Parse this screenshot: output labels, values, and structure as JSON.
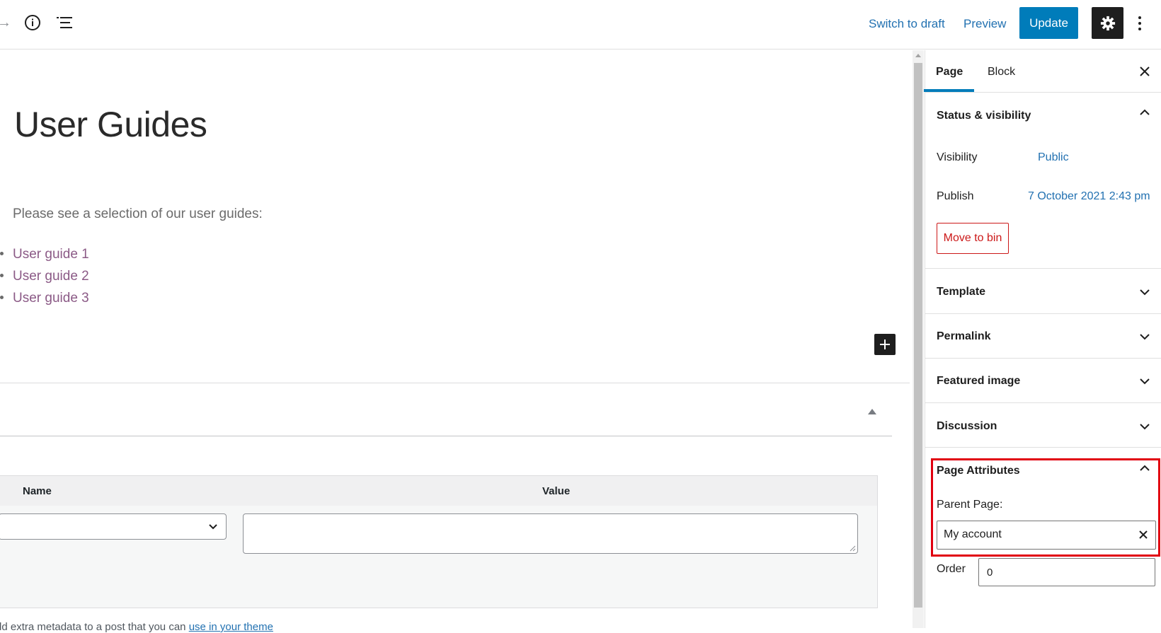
{
  "toolbar": {
    "redo_icon": "arrow-right-icon",
    "info_icon": "info-icon",
    "list_view_icon": "list-view-icon",
    "switch_to_draft": "Switch to draft",
    "preview": "Preview",
    "update": "Update",
    "settings_icon": "gear-icon",
    "more_icon": "vertical-ellipsis-icon"
  },
  "editor": {
    "title": "User Guides",
    "paragraph": "Please see a selection of our user guides:",
    "list_items": [
      "User guide 1",
      "User guide 2",
      "User guide 3"
    ],
    "add_block_icon": "plus-icon"
  },
  "custom_fields": {
    "columns": {
      "name": "Name",
      "value": "Value"
    },
    "help_text": "dd extra metadata to a post that you can ",
    "help_link": "use in your theme"
  },
  "sidebar": {
    "tabs": [
      "Page",
      "Block"
    ],
    "active_tab": "Page",
    "status_visibility": {
      "title": "Status & visibility",
      "visibility_label": "Visibility",
      "visibility_value": "Public",
      "publish_label": "Publish",
      "publish_value": "7 October 2021 2:43 pm",
      "move_to_bin": "Move to bin"
    },
    "panels": [
      "Template",
      "Permalink",
      "Featured image",
      "Discussion"
    ],
    "page_attributes": {
      "title": "Page Attributes",
      "parent_label": "Parent Page:",
      "parent_value": "My account",
      "order_label": "Order",
      "order_value": "0"
    }
  },
  "colors": {
    "accent": "#007cba",
    "link": "#2271b1",
    "danger": "#cc1818",
    "highlight": "#e1000f",
    "list_link": "#8b5a86"
  }
}
